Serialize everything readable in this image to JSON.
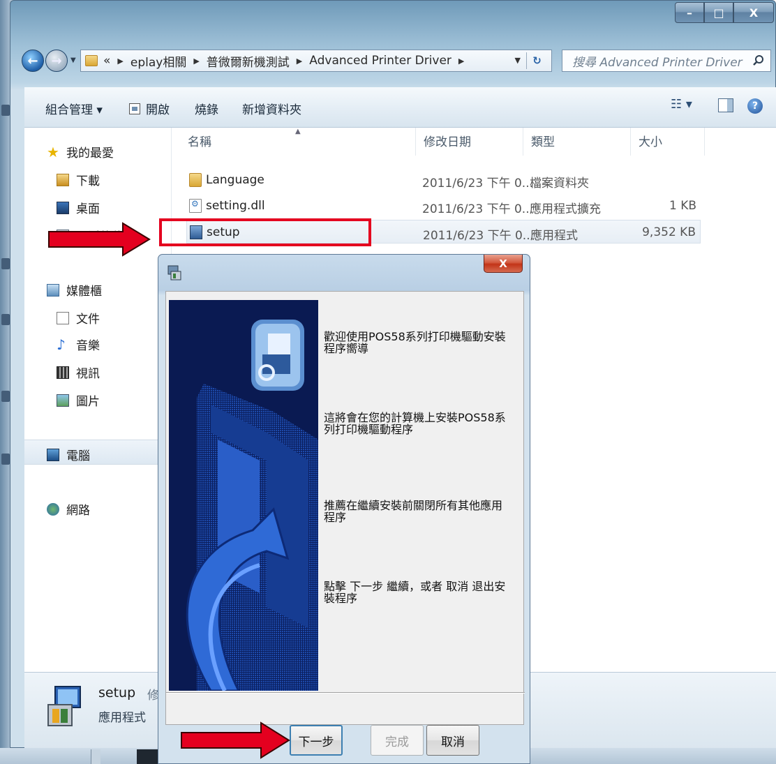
{
  "window": {
    "controls": {
      "minimize": "–",
      "maximize": "□",
      "close": "X"
    }
  },
  "address_bar": {
    "overflow": "«",
    "crumbs": [
      "eplay相關",
      "普微爾新機測試",
      "Advanced Printer Driver"
    ],
    "search_placeholder": "搜尋 Advanced Printer Driver"
  },
  "toolbar": {
    "organize": "組合管理 ▾",
    "open": "開啟",
    "burn": "燒錄",
    "new_folder": "新增資料夾",
    "view": "☷ ▾",
    "help": "?"
  },
  "nav_pane": {
    "favorites": "我的最愛",
    "downloads": "下載",
    "desktop": "桌面",
    "recent": "最近的位置",
    "libraries": "媒體櫃",
    "documents": "文件",
    "music": "音樂",
    "videos": "視訊",
    "pictures": "圖片",
    "computer": "電腦",
    "network": "網路"
  },
  "file_list": {
    "columns": {
      "name": "名稱",
      "modified": "修改日期",
      "type": "類型",
      "size": "大小"
    },
    "rows": [
      {
        "name": "Language",
        "modified": "2011/6/23 下午 0...",
        "type": "檔案資料夾",
        "size": ""
      },
      {
        "name": "setting.dll",
        "modified": "2011/6/23 下午 0...",
        "type": "應用程式擴充",
        "size": "1 KB"
      },
      {
        "name": "setup",
        "modified": "2011/6/23 下午 0...",
        "type": "應用程式",
        "size": "9,352 KB"
      }
    ]
  },
  "details": {
    "name": "setup",
    "modified_label": "修改",
    "type": "應用程式"
  },
  "dialog": {
    "close": "X",
    "text": {
      "welcome": "歡迎使用POS58系列打印機驅動安裝程序嚮導",
      "install": "這將會在您的計算機上安裝POS58系列打印機驅動程序",
      "recommend": "推薦在繼續安裝前關閉所有其他應用程序",
      "instruction": "點擊 下一步 繼續，或者 取消 退出安裝程序"
    },
    "buttons": {
      "next": "下一步",
      "finish": "完成",
      "cancel": "取消"
    }
  },
  "colors": {
    "highlight": "#e4001f",
    "banner": "#0b1f5f",
    "accent_blue": "#2b64a8"
  }
}
